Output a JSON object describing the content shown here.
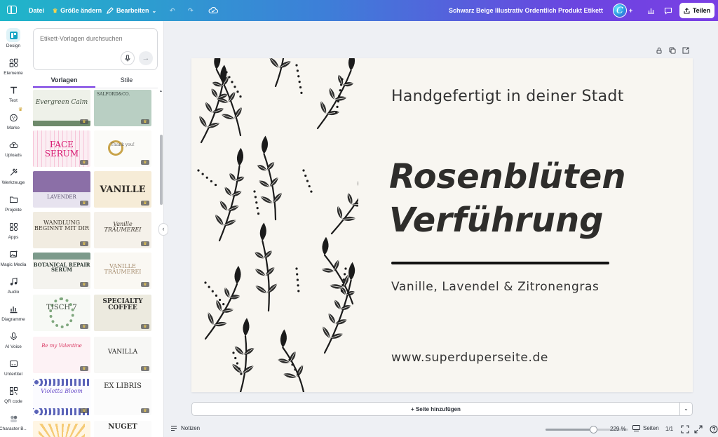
{
  "topbar": {
    "file": "Datei",
    "resize": "Größe ändern",
    "edit": "Bearbeiten",
    "doc_title": "Schwarz Beige Illustrativ Ordentlich Produkt Etikett",
    "avatar": "C",
    "share": "Teilen"
  },
  "rail": {
    "items": [
      {
        "label": "Design",
        "icon": "design-icon"
      },
      {
        "label": "Elemente",
        "icon": "elements-icon"
      },
      {
        "label": "Text",
        "icon": "text-icon"
      },
      {
        "label": "Marke",
        "icon": "brand-icon"
      },
      {
        "label": "Uploads",
        "icon": "upload-icon"
      },
      {
        "label": "Werkzeuge",
        "icon": "tools-icon"
      },
      {
        "label": "Projekte",
        "icon": "folder-icon"
      },
      {
        "label": "Apps",
        "icon": "apps-icon"
      },
      {
        "label": "Magic Media",
        "icon": "magic-media-icon"
      },
      {
        "label": "Audio",
        "icon": "audio-icon"
      },
      {
        "label": "Diagramme",
        "icon": "chart-icon"
      },
      {
        "label": "AI Voice",
        "icon": "ai-voice-icon"
      },
      {
        "label": "Untertitel",
        "icon": "subtitle-icon"
      },
      {
        "label": "QR code",
        "icon": "qr-code-icon"
      },
      {
        "label": "Character B...",
        "icon": "character-icon"
      }
    ]
  },
  "panel": {
    "search_placeholder": "Etikett-Vorlagen durchsuchen",
    "tabs": [
      "Vorlagen",
      "Stile"
    ],
    "templates": [
      {
        "text": "Evergreen Calm"
      },
      {
        "text": "SALFORD&CO."
      },
      {
        "text": "FACE SERUM"
      },
      {
        "text": "Thank you!"
      },
      {
        "text": "LAVENDER"
      },
      {
        "text": "VANILLE"
      },
      {
        "text": "WANDLUNG BEGINNT MIT DIR"
      },
      {
        "text": "Vanille TRÄUMEREI"
      },
      {
        "text": "BOTANICAL REPAIR SERUM"
      },
      {
        "text": "VANILLE TRÄUMEREI"
      },
      {
        "text": "TISCH 7"
      },
      {
        "text": "SPECIALTY COFFEE"
      },
      {
        "text": "Be my Valentine"
      },
      {
        "text": "VANILLA"
      },
      {
        "text": "Violetta Bloom"
      },
      {
        "text": "EX LIBRIS"
      },
      {
        "text": ""
      },
      {
        "text": "NUGET"
      }
    ]
  },
  "page": {
    "tagline": "Handgefertigt in deiner Stadt",
    "title_line1": "Rosenblüten",
    "title_line2": "Verführung",
    "ingredients": "Vanille, Lavendel & Zitronengras",
    "url": "www.superduperseite.de"
  },
  "canvas": {
    "add_page": "+ Seite hinzufügen"
  },
  "bottombar": {
    "notes": "Notizen",
    "zoom": "229 %",
    "zoom_level": 0.58,
    "pages": "Seiten",
    "page_count": "1/1"
  }
}
